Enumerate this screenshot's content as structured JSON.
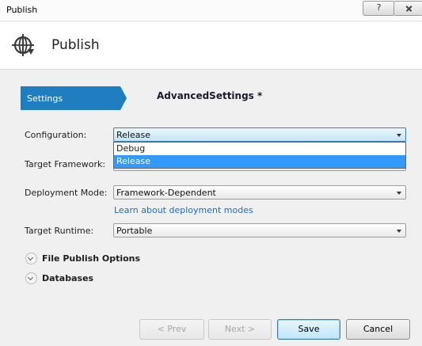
{
  "window": {
    "title": "Publish",
    "help_label": "?"
  },
  "header": {
    "title": "Publish",
    "icon": "globe-icon"
  },
  "steps": {
    "settings_label": "Settings",
    "page_title": "AdvancedSettings *"
  },
  "form": {
    "configuration": {
      "label": "Configuration:",
      "value": "Release",
      "options": [
        "Debug",
        "Release"
      ]
    },
    "target_framework": {
      "label": "Target Framework:"
    },
    "deployment_mode": {
      "label": "Deployment Mode:",
      "value": "Framework-Dependent",
      "link": "Learn about deployment modes"
    },
    "target_runtime": {
      "label": "Target Runtime:",
      "value": "Portable"
    }
  },
  "sections": [
    {
      "label": "File Publish Options"
    },
    {
      "label": "Databases"
    }
  ],
  "buttons": {
    "prev": "< Prev",
    "next": "Next >",
    "save": "Save",
    "cancel": "Cancel"
  },
  "colors": {
    "accent": "#1f7ebf",
    "selection": "#3399ff",
    "link": "#1a6fc2"
  }
}
